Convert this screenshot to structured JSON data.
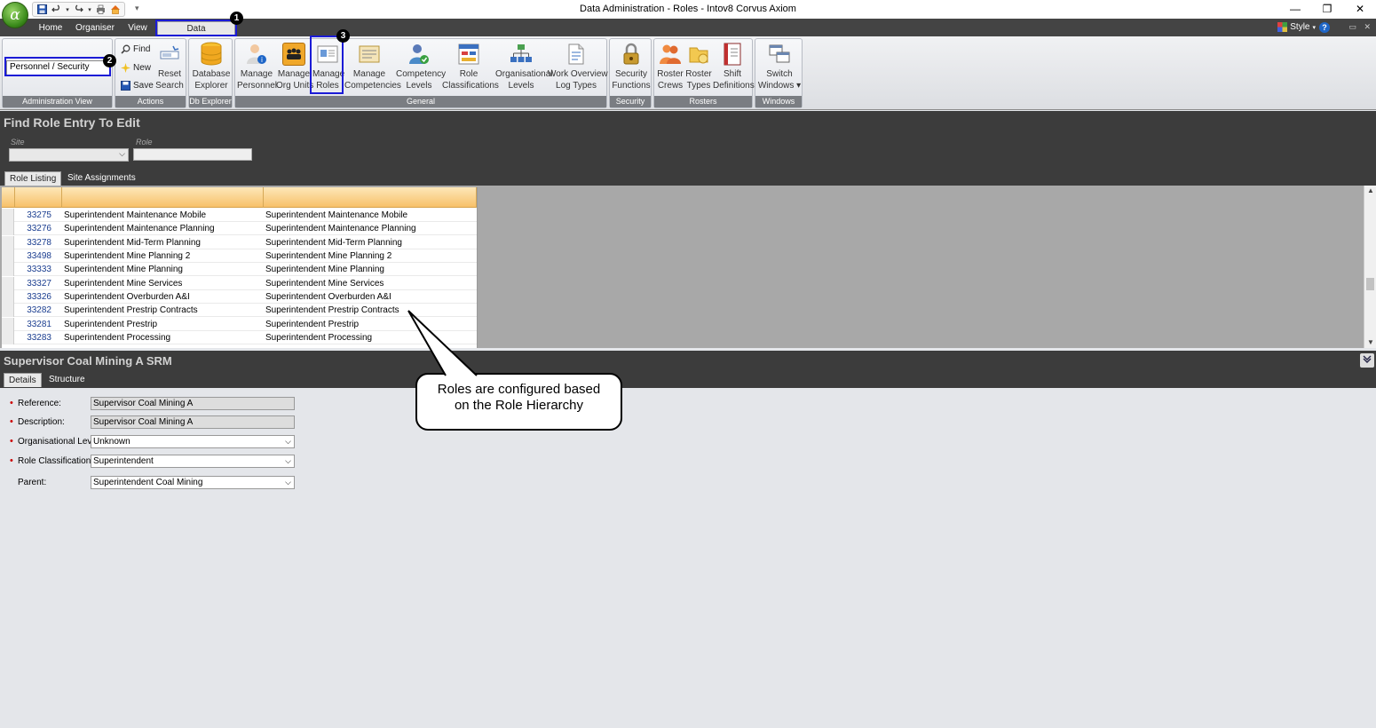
{
  "window": {
    "title": "Data Administration - Roles - Intov8 Corvus Axiom",
    "orb_glyph": "α",
    "minimize": "—",
    "restore": "❐",
    "close": "✕"
  },
  "ribbon_tabs": [
    "Home",
    "Organiser",
    "View",
    "Data Administration"
  ],
  "style_label": "Style",
  "admin_view": {
    "selected": "Personnel / Security",
    "group_label": "Administration View"
  },
  "actions": {
    "find": "Find",
    "new": "New",
    "save": "Save",
    "reset_line1": "Reset",
    "reset_line2": "Search",
    "group_label": "Actions"
  },
  "db_explorer": {
    "line1": "Database",
    "line2": "Explorer",
    "group_label": "Db Explorer"
  },
  "general": {
    "group_label": "General",
    "buttons": [
      {
        "line1": "Manage",
        "line2": "Personnel"
      },
      {
        "line1": "Manage",
        "line2": "Org Units"
      },
      {
        "line1": "Manage",
        "line2": "Roles"
      },
      {
        "line1": "Manage",
        "line2": "Competencies"
      },
      {
        "line1": "Competency",
        "line2": "Levels"
      },
      {
        "line1": "Role",
        "line2": "Classifications"
      },
      {
        "line1": "Organisational",
        "line2": "Levels"
      },
      {
        "line1": "Work Overview",
        "line2": "Log Types"
      }
    ]
  },
  "security": {
    "group_label": "Security",
    "line1": "Security",
    "line2": "Functions"
  },
  "rosters": {
    "group_label": "Rosters",
    "buttons": [
      {
        "line1": "Roster",
        "line2": "Crews"
      },
      {
        "line1": "Roster",
        "line2": "Types"
      },
      {
        "line1": "Shift",
        "line2": "Definitions"
      }
    ]
  },
  "windows": {
    "group_label": "Windows",
    "line1": "Switch",
    "line2": "Windows ▾"
  },
  "badges": [
    "1",
    "2",
    "3"
  ],
  "find_panel": {
    "title": "Find Role Entry To Edit",
    "site_label": "Site",
    "role_label": "Role",
    "site_value": "",
    "role_value": ""
  },
  "list_tabs": [
    "Role Listing",
    "Site Assignments"
  ],
  "roles": [
    {
      "id": "33275",
      "reference": "Superintendent Maintenance Mobile",
      "description": "Superintendent Maintenance Mobile"
    },
    {
      "id": "33276",
      "reference": "Superintendent Maintenance Planning",
      "description": "Superintendent Maintenance Planning"
    },
    {
      "id": "33278",
      "reference": "Superintendent Mid-Term Planning",
      "description": "Superintendent Mid-Term Planning"
    },
    {
      "id": "33498",
      "reference": "Superintendent Mine Planning 2",
      "description": "Superintendent Mine Planning 2"
    },
    {
      "id": "33333",
      "reference": "Superintendent Mine Planning",
      "description": "Superintendent Mine Planning"
    },
    {
      "id": "33327",
      "reference": "Superintendent Mine Services",
      "description": "Superintendent Mine Services"
    },
    {
      "id": "33326",
      "reference": "Superintendent Overburden A&I",
      "description": "Superintendent Overburden A&I"
    },
    {
      "id": "33282",
      "reference": "Superintendent Prestrip Contracts",
      "description": "Superintendent Prestrip Contracts"
    },
    {
      "id": "33281",
      "reference": "Superintendent Prestrip",
      "description": "Superintendent Prestrip"
    },
    {
      "id": "33283",
      "reference": "Superintendent Processing",
      "description": "Superintendent Processing"
    }
  ],
  "detail": {
    "title": "Supervisor Coal Mining A SRM",
    "tabs": [
      "Details",
      "Structure"
    ],
    "fields": {
      "reference_label": "Reference:",
      "reference_value": "Supervisor Coal Mining A",
      "description_label": "Description:",
      "description_value": "Supervisor Coal Mining A",
      "org_level_label": "Organisational Level:",
      "org_level_value": "Unknown",
      "role_class_label": "Role Classification:",
      "role_class_value": "Superintendent",
      "parent_label": "Parent:",
      "parent_value": "Superintendent Coal Mining"
    }
  },
  "callout": {
    "line1": "Roles are configured based",
    "line2": "on the Role Hierarchy"
  },
  "colors": {
    "highlight": "#1b1bd6",
    "dark_panel": "#3c3c3c",
    "grid_header": "#f7c16a"
  }
}
